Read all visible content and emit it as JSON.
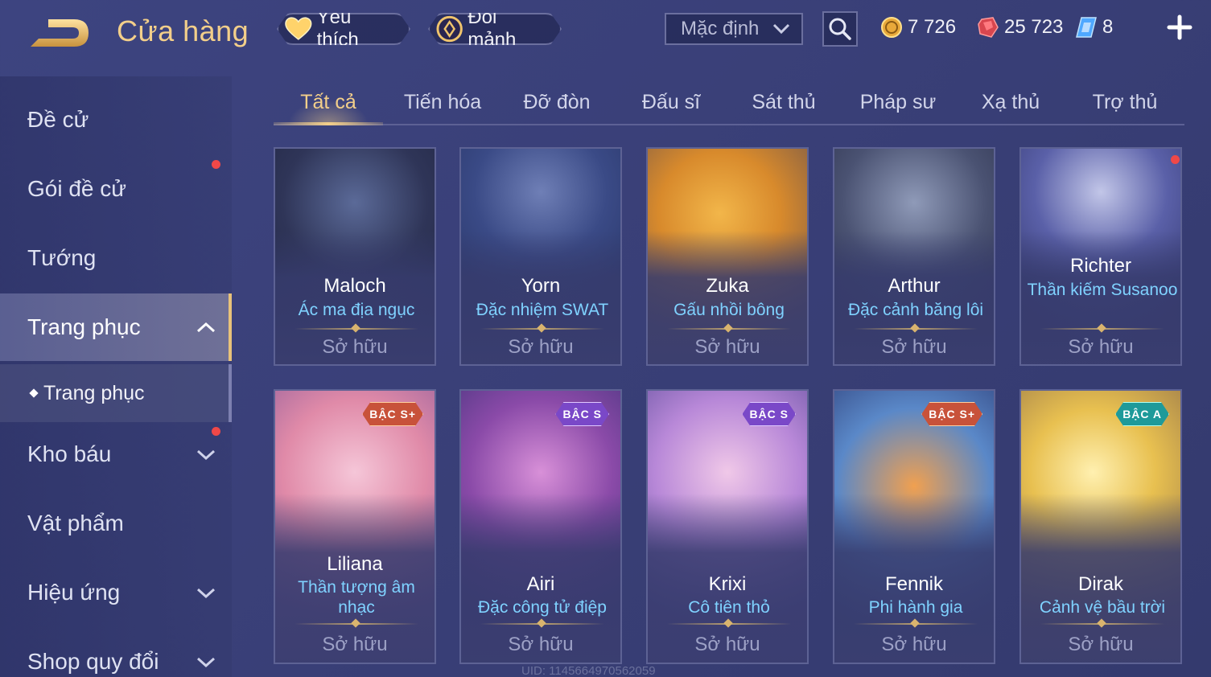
{
  "header": {
    "title": "Cửa hàng",
    "favorites_label": "Yêu thích",
    "exchange_label": "Đổi mảnh",
    "sort_selected": "Mặc định",
    "currencies": [
      {
        "icon": "gold-coin-icon",
        "value": "7 726"
      },
      {
        "icon": "ruby-gem-icon",
        "value": "25 723"
      },
      {
        "icon": "voucher-icon",
        "value": "8"
      }
    ]
  },
  "sidebar": {
    "items": [
      {
        "label": "Đề cử"
      },
      {
        "label": "Gói đề cử",
        "notification": true
      },
      {
        "label": "Tướng"
      },
      {
        "label": "Trang phục",
        "active": true,
        "expanded": true
      },
      {
        "label": "Trang phục",
        "sub": true
      },
      {
        "label": "Kho báu",
        "notification": true
      },
      {
        "label": "Vật phẩm"
      },
      {
        "label": "Hiệu ứng"
      },
      {
        "label": "Shop quy đổi"
      }
    ]
  },
  "tabs": [
    {
      "label": "Tất cả",
      "active": true
    },
    {
      "label": "Tiến hóa"
    },
    {
      "label": "Đỡ đòn"
    },
    {
      "label": "Đấu sĩ"
    },
    {
      "label": "Sát thủ"
    },
    {
      "label": "Pháp sư"
    },
    {
      "label": "Xạ thủ"
    },
    {
      "label": "Trợ thủ"
    }
  ],
  "skins": [
    {
      "hero": "Maloch",
      "skin": "Ác ma địa ngục",
      "status": "Sở hữu",
      "tier": ""
    },
    {
      "hero": "Yorn",
      "skin": "Đặc nhiệm SWAT",
      "status": "Sở hữu",
      "tier": ""
    },
    {
      "hero": "Zuka",
      "skin": "Gấu nhồi bông",
      "status": "Sở hữu",
      "tier": ""
    },
    {
      "hero": "Arthur",
      "skin": "Đặc cảnh băng lôi",
      "status": "Sở hữu",
      "tier": ""
    },
    {
      "hero": "Richter",
      "skin": "Thần kiếm Susanoo",
      "status": "Sở hữu",
      "tier": "",
      "notification": true
    },
    {
      "hero": "Liliana",
      "skin": "Thần tượng âm nhạc",
      "status": "Sở hữu",
      "tier": "BẬC S+"
    },
    {
      "hero": "Airi",
      "skin": "Đặc công tử điệp",
      "status": "Sở hữu",
      "tier": "BẬC S"
    },
    {
      "hero": "Krixi",
      "skin": "Cô tiên thỏ",
      "status": "Sở hữu",
      "tier": "BẬC S"
    },
    {
      "hero": "Fennik",
      "skin": "Phi hành gia",
      "status": "Sở hữu",
      "tier": "BẬC S+"
    },
    {
      "hero": "Dirak",
      "skin": "Cảnh vệ bầu trời",
      "status": "Sở hữu",
      "tier": "BẬC A"
    }
  ],
  "footer": {
    "uid": "UID: 1145664970562059"
  },
  "colors": {
    "accent_gold": "#f3cf8a",
    "skin_name_blue": "#7fd2ff",
    "tier_s_plus": "#c8523a",
    "tier_s": "#7a48c8",
    "tier_a": "#1e9a9a",
    "notification_red": "#f04848"
  }
}
